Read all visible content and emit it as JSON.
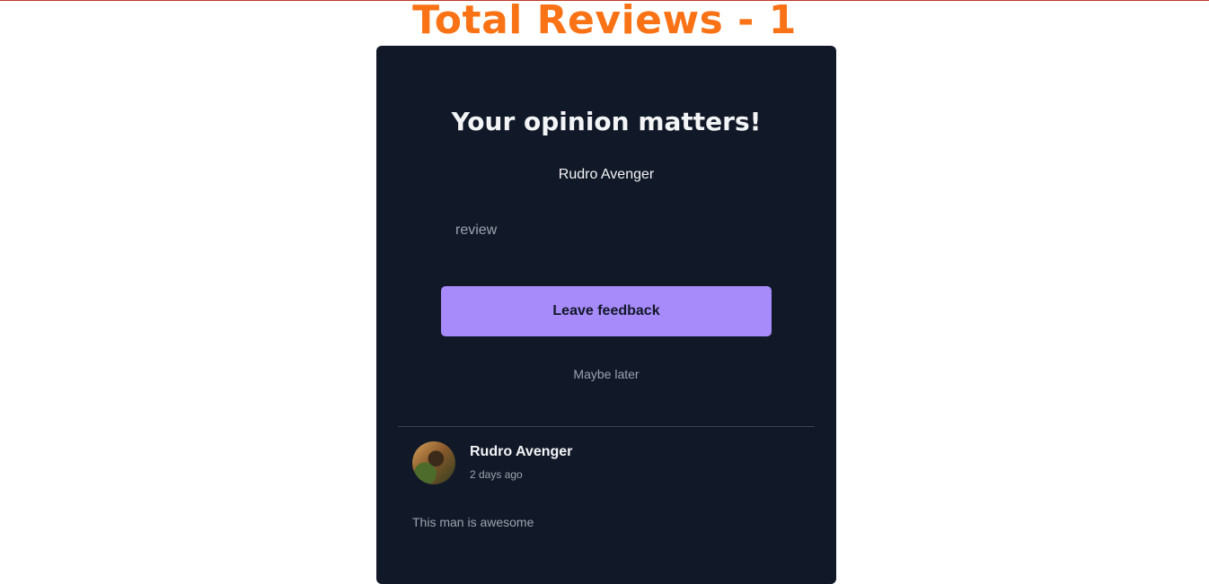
{
  "header": {
    "title": "Total Reviews - 1"
  },
  "feedback_card": {
    "heading": "Your opinion matters!",
    "user_name": "Rudro Avenger",
    "review_placeholder": "review",
    "submit_label": "Leave feedback",
    "later_label": "Maybe later"
  },
  "reviews": [
    {
      "author": "Rudro Avenger",
      "time": "2 days ago",
      "text": "This man is awesome"
    }
  ],
  "colors": {
    "title": "#f97316",
    "card_background": "#111827",
    "button": "#a78bfa"
  }
}
